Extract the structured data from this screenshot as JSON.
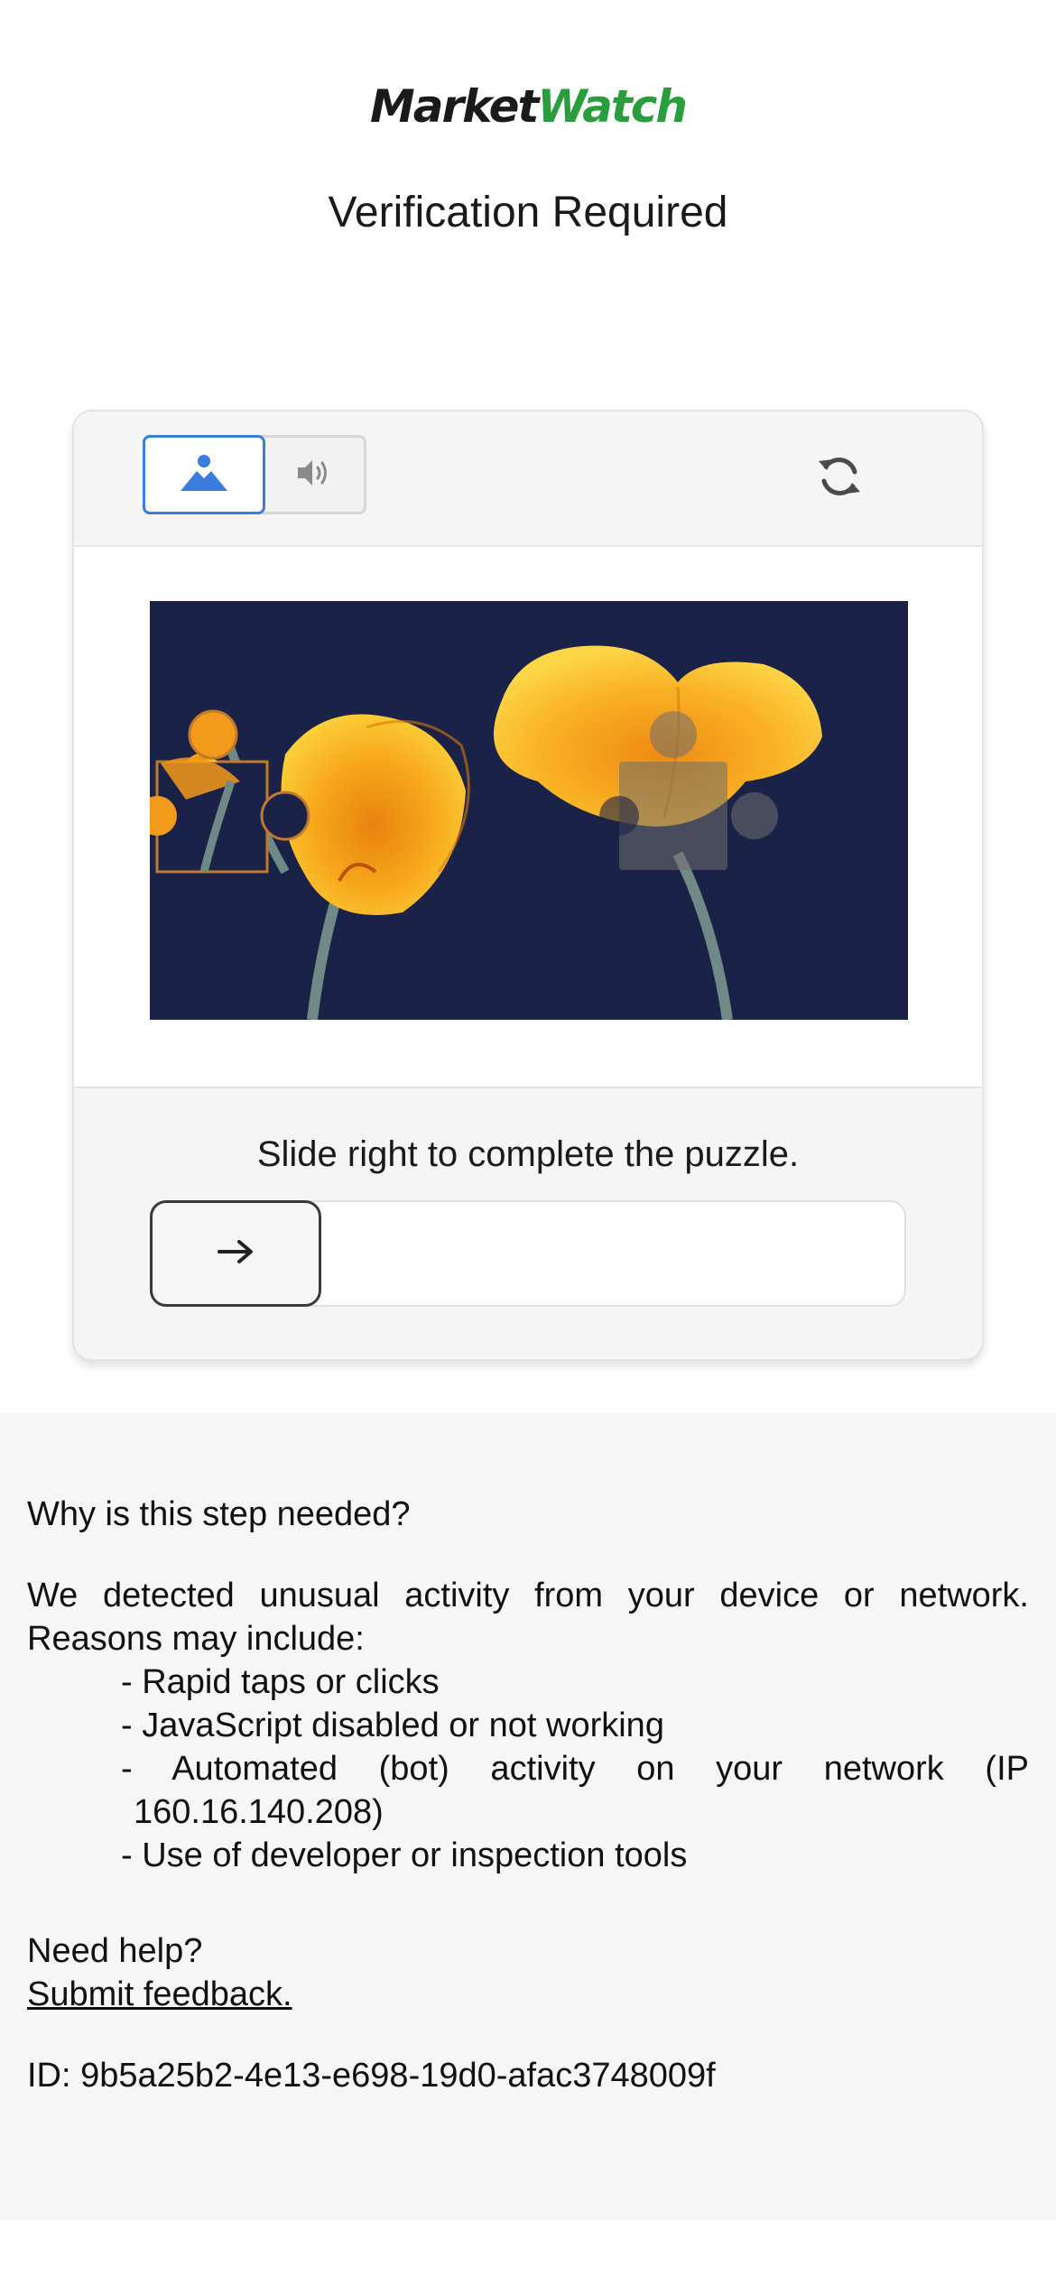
{
  "header": {
    "logo_part1": "Market",
    "logo_part2": "Watch",
    "title": "Verification Required"
  },
  "captcha": {
    "modes": [
      {
        "icon": "image-icon",
        "selected": true
      },
      {
        "icon": "speaker-icon",
        "selected": false
      }
    ],
    "refresh_icon": "refresh-icon",
    "instruction": "Slide right to complete the puzzle.",
    "slider_icon": "arrow-right-icon",
    "accent_color": "#3b7ddd"
  },
  "info": {
    "why_heading": "Why is this step needed?",
    "reasons_intro": "We detected unusual activity from your device or network. Reasons may include:",
    "reasons": [
      "- Rapid taps or clicks",
      "- JavaScript disabled or not working",
      "- Automated (bot) activity on your network (IP 160.16.140.208)",
      "- Use of developer or inspection tools"
    ],
    "help_heading": "Need help?",
    "feedback_link": "Submit feedback.",
    "id_line": "ID: 9b5a25b2-4e13-e698-19d0-afac3748009f"
  },
  "colors": {
    "brand_green": "#2a9d3c",
    "text": "#111111",
    "card_border": "#e3e3e3",
    "info_background": "#f6f6f6"
  }
}
